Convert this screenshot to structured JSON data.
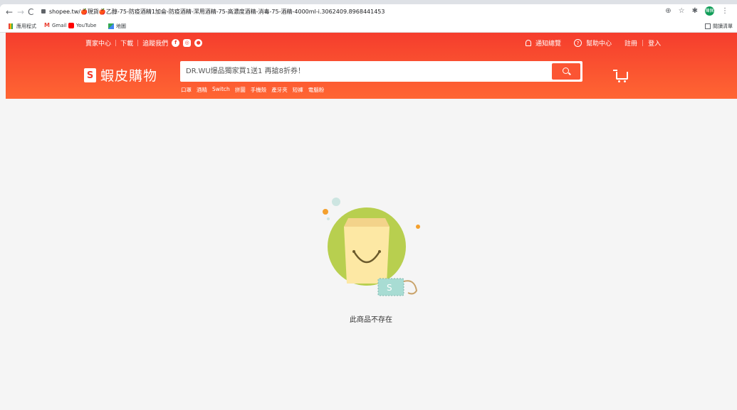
{
  "browser": {
    "url": "shopee.tw/🍎現貨🍎乙醇-75-防疫酒精1加侖-防疫酒精-潔用酒精-75-高濃度酒精-消毒-75-酒精-4000ml-i.3062409.8968441453",
    "profile_initials": "陳佩",
    "bookmarks": [
      "應用程式",
      "Gmail",
      "YouTube",
      "地圖"
    ],
    "reading_list": "閱讀清單"
  },
  "header": {
    "seller_center": "賣家中心",
    "download": "下載",
    "follow_us": "追蹤我們",
    "notifications": "通知總覽",
    "help_center": "幫助中心",
    "register": "註冊",
    "login": "登入",
    "brand": "蝦皮購物",
    "search_placeholder": "DR.WU爆品獨家買1送1 再搶8折券！",
    "hints": [
      "口罩",
      "酒精",
      "Switch",
      "拼圖",
      "手機殼",
      "產牙夾",
      "短褲",
      "電腦粉"
    ]
  },
  "main": {
    "message": "此商品不存在"
  },
  "colors": {
    "brand": "#f53d2d",
    "brand_light": "#ff6633"
  }
}
